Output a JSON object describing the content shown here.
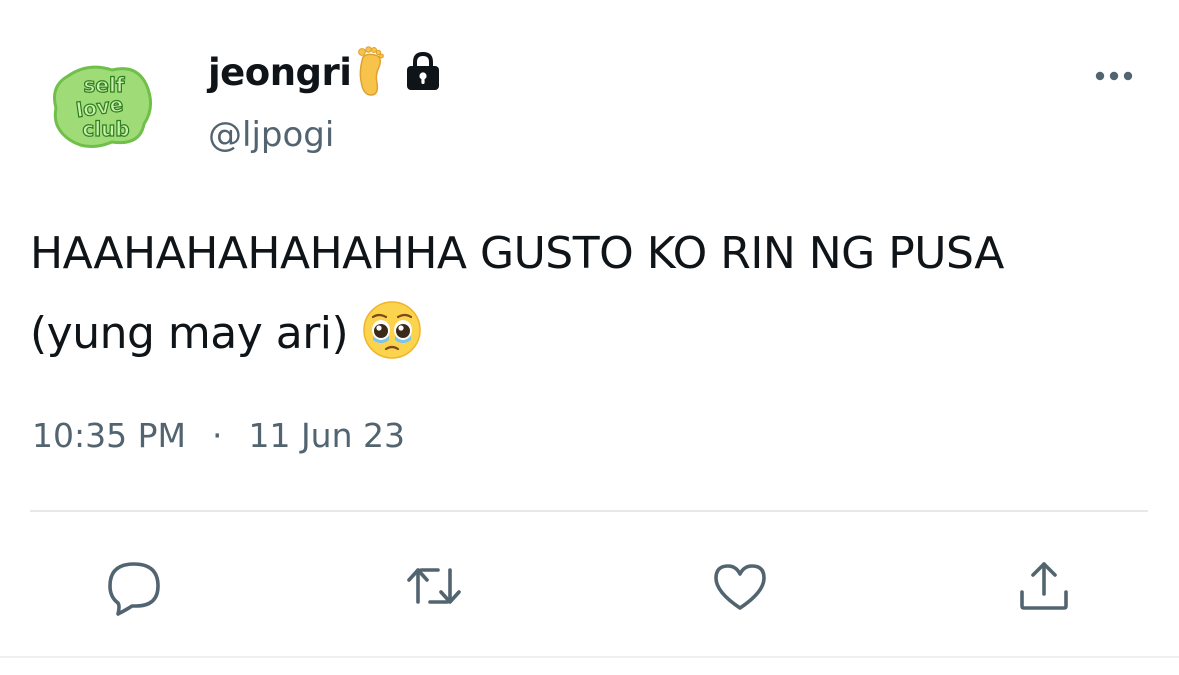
{
  "user": {
    "display_name": "jeongri",
    "handle": "@ljpogi",
    "avatar_text": [
      "self",
      "love",
      "club"
    ],
    "name_emoji_icon": "foot-emoji-icon",
    "protected_icon": "lock-icon"
  },
  "tweet": {
    "line1": "HAAHAHAHAHAHHA GUSTO KO RIN NG PUSA",
    "line2": "(yung may ari)",
    "emoji_icon": "pleading-face-emoji-icon",
    "time": "10:35 PM",
    "separator": "·",
    "date": "11 Jun 23"
  },
  "actions": {
    "reply_icon": "reply-icon",
    "retweet_icon": "retweet-icon",
    "like_icon": "heart-icon",
    "share_icon": "share-icon",
    "more_icon": "more-dots-icon"
  },
  "colors": {
    "text": "#0f1419",
    "secondary": "#536471",
    "divider": "#e5e9ec",
    "avatar_green": "#8fd46a",
    "avatar_text_green": "#2f7d1e"
  }
}
